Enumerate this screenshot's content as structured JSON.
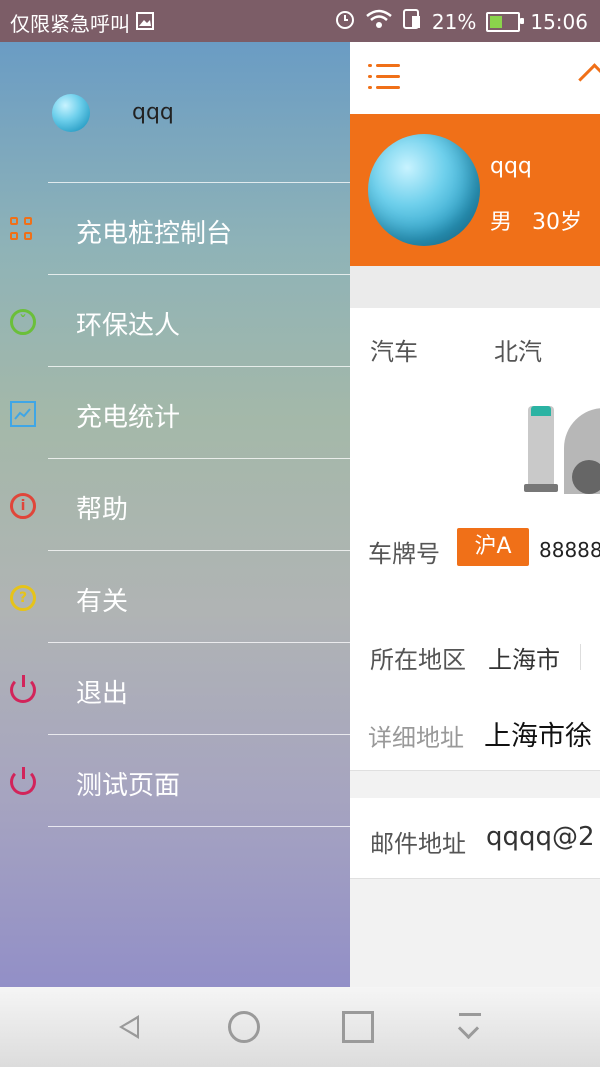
{
  "status_bar": {
    "left_text": "仅限紧急呼叫",
    "battery": "21%",
    "time": "15:06"
  },
  "drawer": {
    "username": "qqq",
    "items": [
      {
        "label": "充电桩控制台",
        "icon": "qr-grid-icon",
        "color": "#f07018"
      },
      {
        "label": "环保达人",
        "icon": "leaf-icon",
        "color": "#6bbf3a"
      },
      {
        "label": "充电统计",
        "icon": "chart-board-icon",
        "color": "#3fa6e6"
      },
      {
        "label": "帮助",
        "icon": "info-icon",
        "color": "#e0463a"
      },
      {
        "label": "有关",
        "icon": "question-icon",
        "color": "#e6c31a"
      },
      {
        "label": "退出",
        "icon": "power-icon",
        "color": "#d2245a"
      },
      {
        "label": "测试页面",
        "icon": "power-icon",
        "color": "#d2245a"
      }
    ]
  },
  "profile": {
    "name": "qqq",
    "gender": "男",
    "age": "30岁"
  },
  "car": {
    "type": "汽车",
    "brand": "北汽"
  },
  "plate": {
    "label": "车牌号",
    "prefix": "沪A",
    "number": "88888"
  },
  "region": {
    "label": "所在地区",
    "value": "上海市"
  },
  "address": {
    "label": "详细地址",
    "value": "上海市徐"
  },
  "email": {
    "label": "邮件地址",
    "value": "qqqq@2"
  },
  "colors": {
    "accent": "#f07018"
  }
}
